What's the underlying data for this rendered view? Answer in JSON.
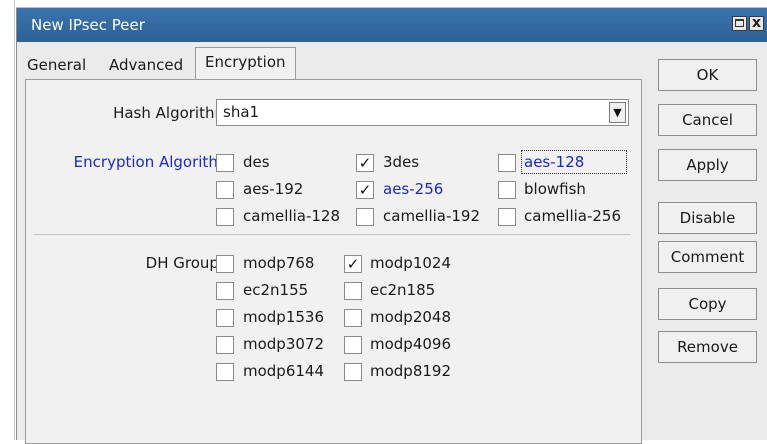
{
  "window": {
    "title": "New IPsec Peer",
    "close_label": "x"
  },
  "tabs": [
    {
      "label": "General"
    },
    {
      "label": "Advanced"
    },
    {
      "label": "Encryption",
      "active": true
    }
  ],
  "hash_algorithm": {
    "label": "Hash Algorithn",
    "value": "sha1"
  },
  "encryption_algorithm": {
    "label": "Encryption Algorithr",
    "options": [
      {
        "label": "des",
        "checked": false
      },
      {
        "label": "3des",
        "checked": true
      },
      {
        "label": "aes-128",
        "checked": false
      },
      {
        "label": "aes-192",
        "checked": false
      },
      {
        "label": "aes-256",
        "checked": true
      },
      {
        "label": "blowfish",
        "checked": false
      },
      {
        "label": "camellia-128",
        "checked": false
      },
      {
        "label": "camellia-192",
        "checked": false
      },
      {
        "label": "camellia-256",
        "checked": false
      }
    ]
  },
  "dh_group": {
    "label": "DH Group:",
    "options": [
      {
        "label": "modp768",
        "checked": false
      },
      {
        "label": "modp1024",
        "checked": true
      },
      {
        "label": "ec2n155",
        "checked": false
      },
      {
        "label": "ec2n185",
        "checked": false
      },
      {
        "label": "modp1536",
        "checked": false
      },
      {
        "label": "modp2048",
        "checked": false
      },
      {
        "label": "modp3072",
        "checked": false
      },
      {
        "label": "modp4096",
        "checked": false
      },
      {
        "label": "modp6144",
        "checked": false
      },
      {
        "label": "modp8192",
        "checked": false
      }
    ]
  },
  "buttons": {
    "ok": "OK",
    "cancel": "Cancel",
    "apply": "Apply",
    "disable": "Disable",
    "comment": "Comment",
    "copy": "Copy",
    "remove": "Remove"
  },
  "colors": {
    "titlebar": "#2f6aa3",
    "highlight_text": "#1c28c4",
    "window_bg": "#ebebeb"
  }
}
